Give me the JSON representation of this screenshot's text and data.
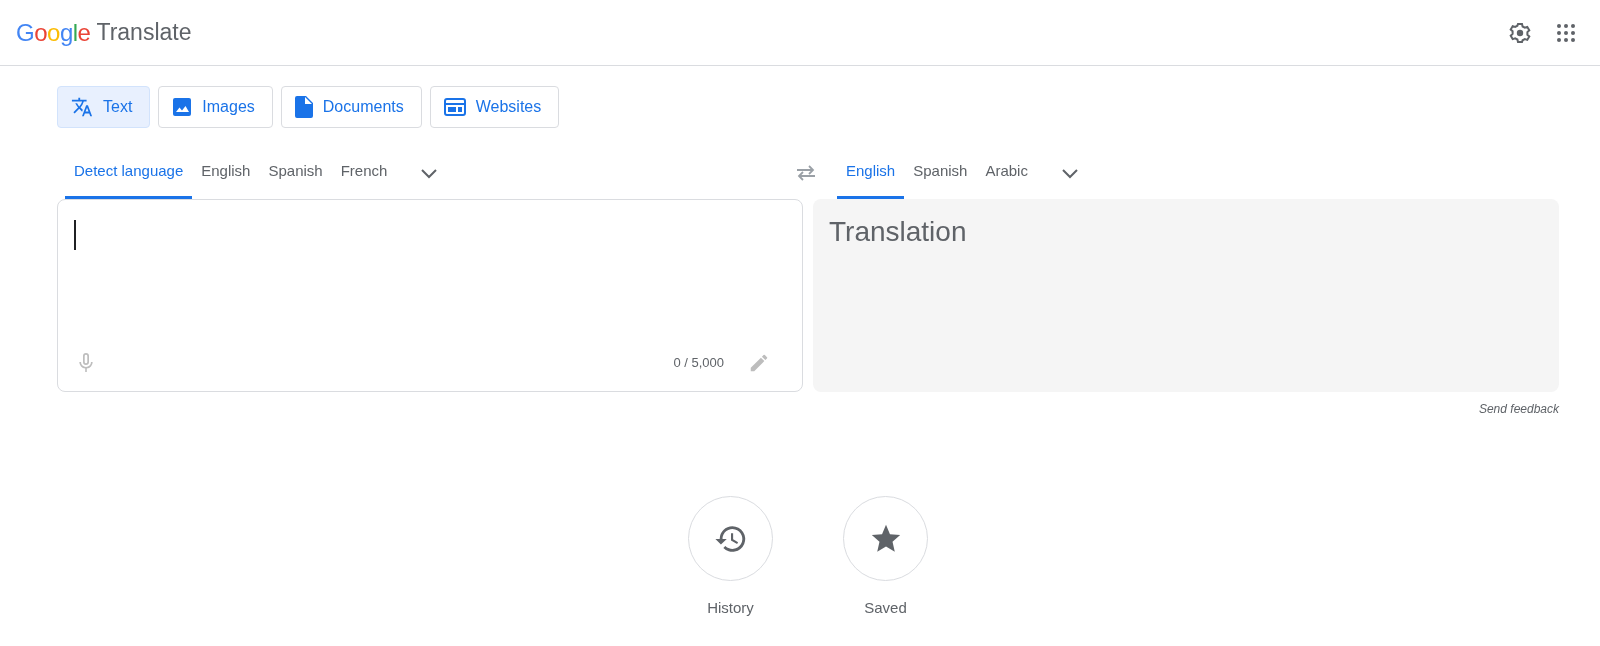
{
  "header": {
    "brand": "Google",
    "product": "Translate"
  },
  "modes": [
    {
      "kind": "text",
      "label": "Text",
      "selected": true
    },
    {
      "kind": "images",
      "label": "Images",
      "selected": false
    },
    {
      "kind": "documents",
      "label": "Documents",
      "selected": false
    },
    {
      "kind": "websites",
      "label": "Websites",
      "selected": false
    }
  ],
  "source_languages": [
    {
      "label": "Detect language",
      "selected": true
    },
    {
      "label": "English",
      "selected": false
    },
    {
      "label": "Spanish",
      "selected": false
    },
    {
      "label": "French",
      "selected": false
    }
  ],
  "target_languages": [
    {
      "label": "English",
      "selected": true
    },
    {
      "label": "Spanish",
      "selected": false
    },
    {
      "label": "Arabic",
      "selected": false
    }
  ],
  "source": {
    "char_count": "0 / 5,000"
  },
  "target": {
    "placeholder": "Translation"
  },
  "feedback": "Send feedback",
  "shortcuts": [
    {
      "kind": "history",
      "label": "History"
    },
    {
      "kind": "saved",
      "label": "Saved"
    }
  ]
}
